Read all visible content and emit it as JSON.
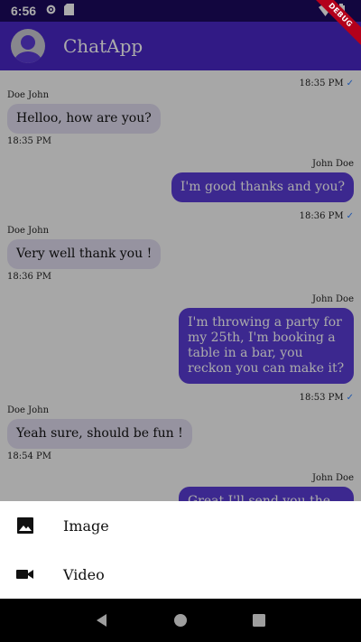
{
  "status_bar": {
    "time": "6:56"
  },
  "debug_banner": "DEBUG",
  "app_bar": {
    "title": "ChatApp"
  },
  "messages": [
    {
      "direction": "out",
      "time": "18:35 PM",
      "read": true
    },
    {
      "direction": "in",
      "sender": "Doe John",
      "text": "Helloo, how are you?",
      "time": "18:35 PM"
    },
    {
      "direction": "out",
      "sender": "John Doe",
      "text": "I'm good thanks and you?",
      "time": "18:36 PM",
      "read": true
    },
    {
      "direction": "in",
      "sender": "Doe John",
      "text": "Very well thank you !",
      "time": "18:36 PM"
    },
    {
      "direction": "out",
      "sender": "John Doe",
      "text": "I'm throwing a party for my 25th, I'm booking a table in a bar, you reckon you can make it?",
      "time": "18:53 PM",
      "read": true
    },
    {
      "direction": "in",
      "sender": "Doe John",
      "text": "Yeah sure, should be fun !",
      "time": "18:54 PM"
    },
    {
      "direction": "out",
      "sender": "John Doe",
      "text": "Great I'll send you the"
    }
  ],
  "bottom_sheet": {
    "items": [
      {
        "label": "Image",
        "icon": "image-icon"
      },
      {
        "label": "Video",
        "icon": "videocam-icon"
      }
    ]
  },
  "nav_bar": {
    "icons": [
      "back-icon",
      "home-icon",
      "recents-icon"
    ]
  },
  "colors": {
    "status_bar": "#1c0a5e",
    "app_bar": "#4a27c7",
    "outgoing_bubble": "#5a3cd6",
    "incoming_bubble": "#e0dcef",
    "read_check": "#2f80ff"
  }
}
